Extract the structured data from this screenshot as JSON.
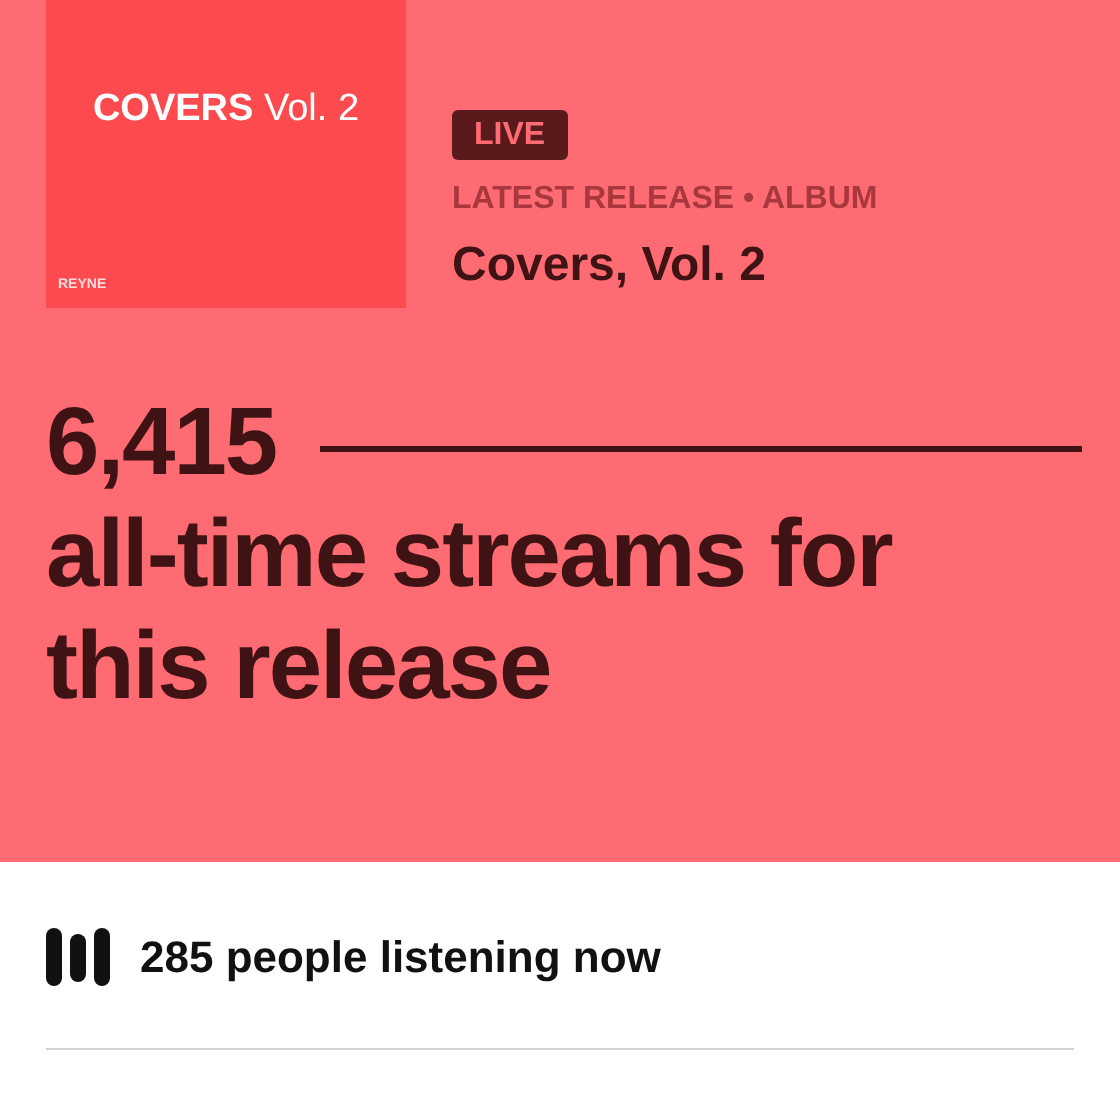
{
  "album_cover": {
    "title_bold": "COVERS",
    "title_rest": "Vol. 2",
    "artist": "REYNE"
  },
  "badge": "LIVE",
  "subtitle": "LATEST RELEASE • ALBUM",
  "release_title": "Covers, Vol. 2",
  "stream_count": "6,415",
  "stream_caption": "all-time streams for this release",
  "listeners": "285 people listening now"
}
